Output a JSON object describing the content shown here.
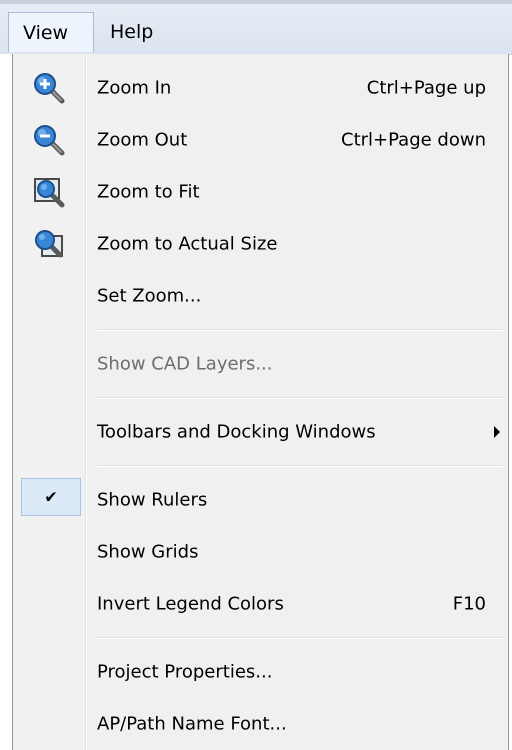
{
  "menubar": {
    "items": [
      {
        "label": "View"
      },
      {
        "label": "Help"
      }
    ]
  },
  "menu": {
    "items": [
      {
        "label": "Zoom In",
        "shortcut": "Ctrl+Page up",
        "icon": "zoom-in-icon"
      },
      {
        "label": "Zoom Out",
        "shortcut": "Ctrl+Page down",
        "icon": "zoom-out-icon"
      },
      {
        "label": "Zoom to Fit",
        "shortcut": "",
        "icon": "zoom-to-fit-icon"
      },
      {
        "label": "Zoom to Actual Size",
        "shortcut": "",
        "icon": "zoom-actual-size-icon"
      },
      {
        "label": "Set Zoom...",
        "shortcut": ""
      },
      {
        "label": "Show CAD Layers...",
        "shortcut": "",
        "disabled": true
      },
      {
        "label": "Toolbars and Docking Windows",
        "shortcut": "",
        "submenu": true
      },
      {
        "label": "Show Rulers",
        "shortcut": "",
        "checked": true
      },
      {
        "label": "Show Grids",
        "shortcut": ""
      },
      {
        "label": "Invert Legend Colors",
        "shortcut": "F10"
      },
      {
        "label": "Project Properties...",
        "shortcut": ""
      },
      {
        "label": "AP/Path Name Font...",
        "shortcut": ""
      }
    ]
  },
  "colors": {
    "menu_bg": "#f0f0f0",
    "checked_bg": "#dbe9f8",
    "disabled_text": "#6d6d6d",
    "icon_blue": "#2e6fb8"
  }
}
